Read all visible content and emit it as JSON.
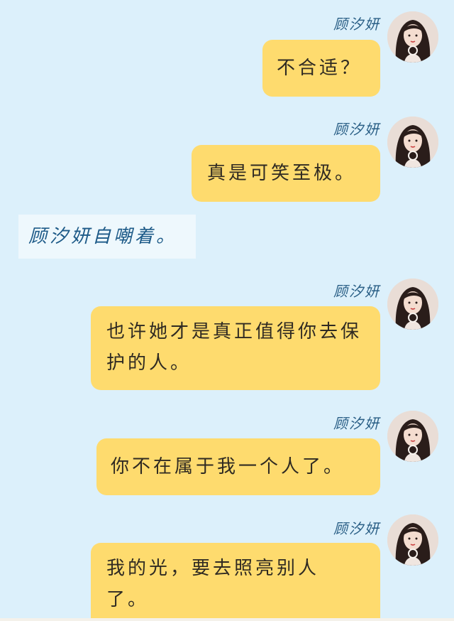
{
  "sender_name": "顾汐妍",
  "messages": [
    {
      "text": "不合适？"
    },
    {
      "text": "真是可笑至极。"
    },
    {
      "text": "也许她才是真正值得你去保护的人。"
    },
    {
      "text": "你不在属于我一个人了。"
    },
    {
      "text": "我的光，要去照亮别人了。"
    }
  ],
  "narration": "顾汐妍自嘲着。",
  "colors": {
    "background": "#dcf0fb",
    "bubble": "#fedb6e",
    "name": "#2a5f86",
    "narration_bg": "#eef8fd"
  }
}
